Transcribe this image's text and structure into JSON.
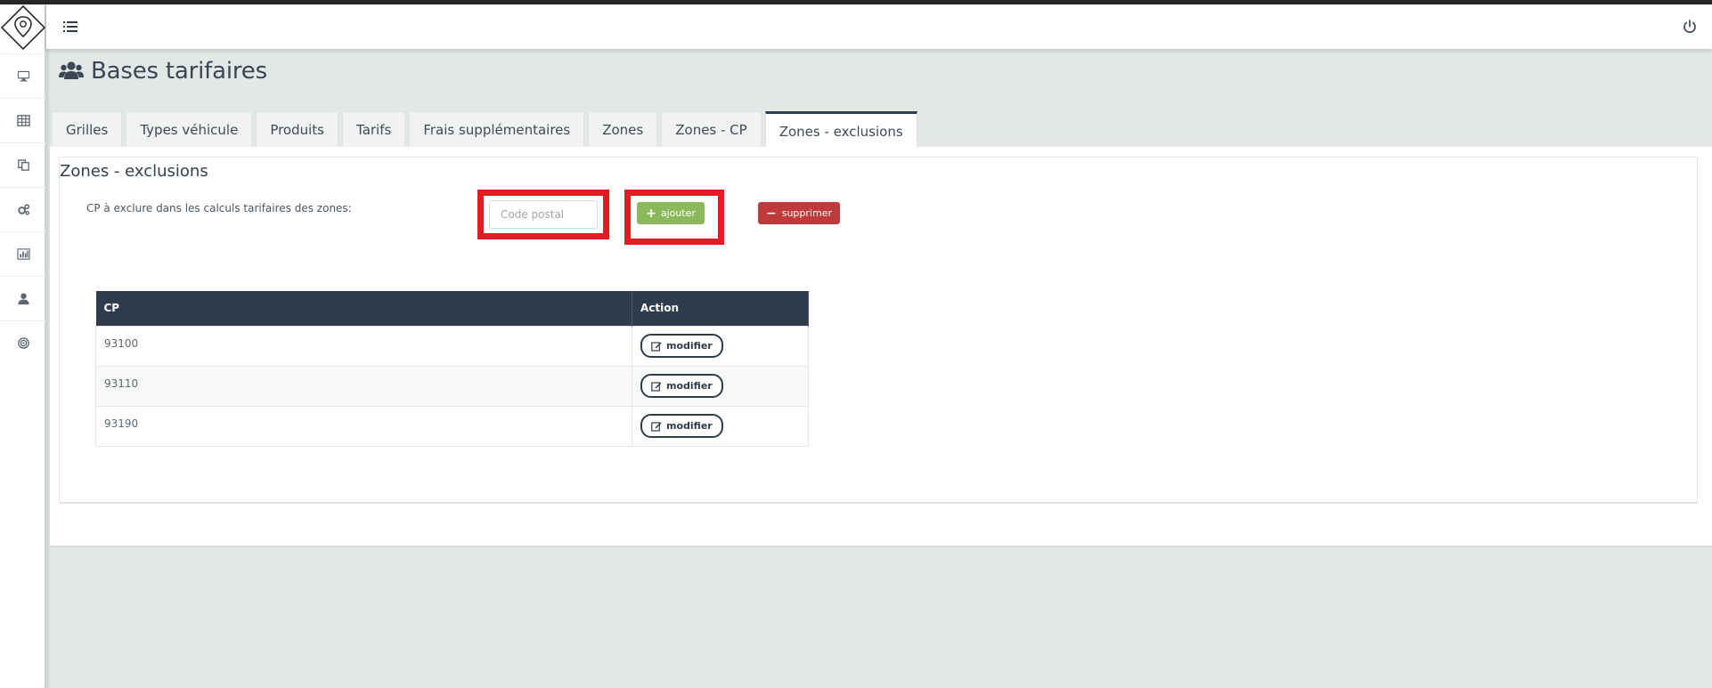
{
  "header": {
    "title": "Bases tarifaires"
  },
  "sidebar": {
    "items": [
      {
        "icon": "desktop-icon"
      },
      {
        "icon": "table-icon"
      },
      {
        "icon": "copy-icon"
      },
      {
        "icon": "gears-icon"
      },
      {
        "icon": "bar-chart-icon"
      },
      {
        "icon": "user-icon"
      },
      {
        "icon": "target-icon"
      }
    ]
  },
  "tabs": [
    {
      "label": "Grilles",
      "active": false
    },
    {
      "label": "Types véhicule",
      "active": false
    },
    {
      "label": "Produits",
      "active": false
    },
    {
      "label": "Tarifs",
      "active": false
    },
    {
      "label": "Frais supplémentaires",
      "active": false
    },
    {
      "label": "Zones",
      "active": false
    },
    {
      "label": "Zones - CP",
      "active": false
    },
    {
      "label": "Zones - exclusions",
      "active": true
    }
  ],
  "panel": {
    "title": "Zones - exclusions",
    "exclude_label": "CP à exclure dans les calculs tarifaires des zones:",
    "cp_input": {
      "value": "",
      "placeholder": "Code postal"
    },
    "add_label": "ajouter",
    "delete_label": "supprimer"
  },
  "table": {
    "headers": [
      "CP",
      "Action"
    ],
    "rows": [
      {
        "cp": "93100",
        "action": "modifier"
      },
      {
        "cp": "93110",
        "action": "modifier"
      },
      {
        "cp": "93190",
        "action": "modifier"
      }
    ]
  },
  "colors": {
    "accent_dark": "#2f3c4b",
    "add_green": "#8cb85c",
    "delete_red": "#c0393b",
    "highlight_red": "#e31b23"
  }
}
